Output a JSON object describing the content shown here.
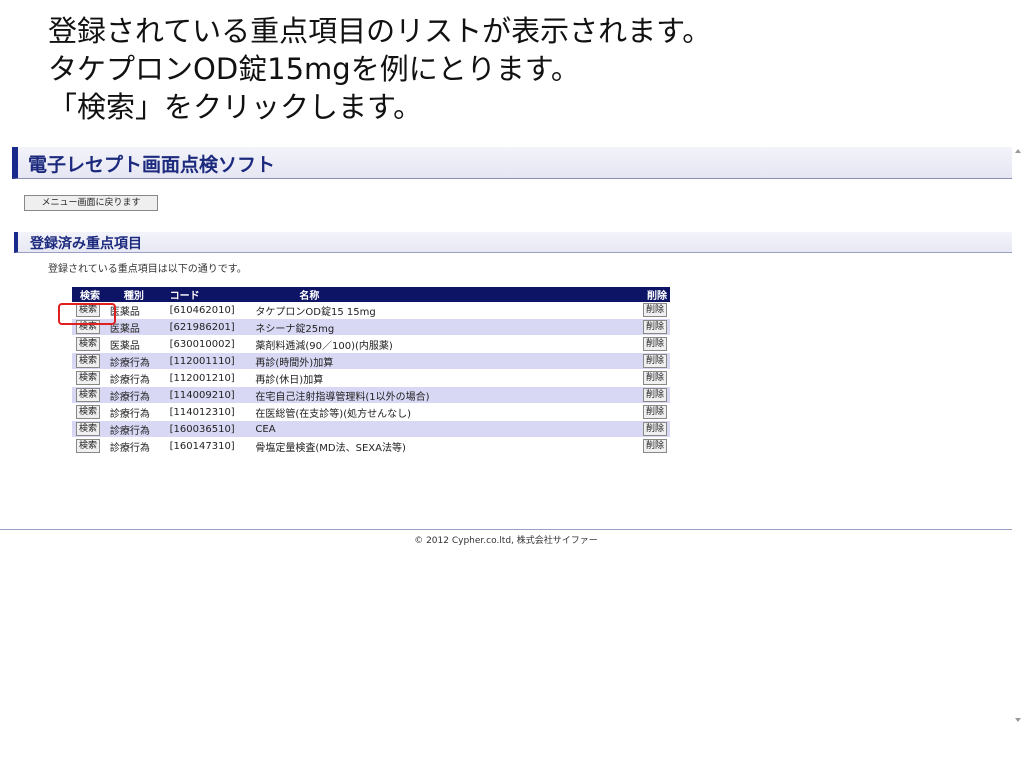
{
  "caption": {
    "line1": "登録されている重点項目のリストが表示されます。",
    "line2": "タケプロンOD錠15mgを例にとります。",
    "line3": "「検索」をクリックします。"
  },
  "app": {
    "title": "電子レセプト画面点検ソフト",
    "menu_button": "メニュー画面に戻ります"
  },
  "section": {
    "title": "登録済み重点項目",
    "description": "登録されている重点項目は以下の通りです。"
  },
  "table": {
    "headers": {
      "search": "検索",
      "kind": "種別",
      "code": "コード",
      "name": "名称",
      "delete": "削除"
    },
    "search_button": "検索",
    "delete_button": "削除",
    "rows": [
      {
        "kind": "医薬品",
        "code": "[610462010]",
        "name": "タケプロンOD錠15 15mg"
      },
      {
        "kind": "医薬品",
        "code": "[621986201]",
        "name": "ネシーナ錠25mg"
      },
      {
        "kind": "医薬品",
        "code": "[630010002]",
        "name": "薬剤料逓減(90／100)(内服薬)"
      },
      {
        "kind": "診療行為",
        "code": "[112001110]",
        "name": "再診(時間外)加算"
      },
      {
        "kind": "診療行為",
        "code": "[112001210]",
        "name": "再診(休日)加算"
      },
      {
        "kind": "診療行為",
        "code": "[114009210]",
        "name": "在宅自己注射指導管理料(1以外の場合)"
      },
      {
        "kind": "診療行為",
        "code": "[114012310]",
        "name": "在医総管(在支診等)(処方せんなし)"
      },
      {
        "kind": "診療行為",
        "code": "[160036510]",
        "name": "CEA"
      },
      {
        "kind": "診療行為",
        "code": "[160147310]",
        "name": "骨塩定量検査(MD法、SEXA法等)"
      }
    ]
  },
  "footer": {
    "copyright": "© 2012 Cypher.co.ltd, 株式会社サイファー"
  },
  "colors": {
    "header_navy": "#0d1466",
    "title_blue": "#1c2a7e",
    "row_alt": "#d8d8f5",
    "highlight_red": "#e02020"
  }
}
